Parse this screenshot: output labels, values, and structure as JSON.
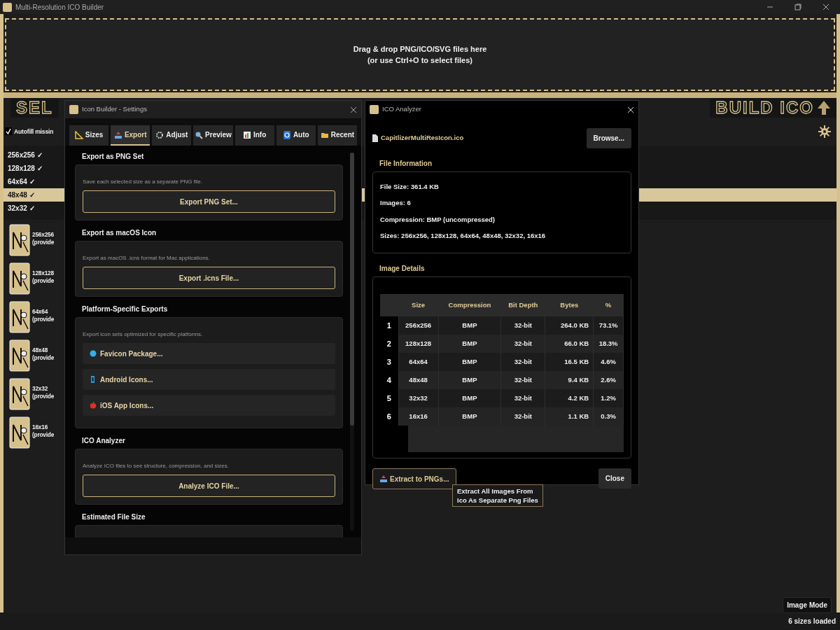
{
  "window": {
    "title": "Multi-Resolution ICO Builder"
  },
  "drop_zone": {
    "line_1": "Drag & drop PNG/ICO/SVG files here",
    "line_2": "(or use Ctrl+O to select files)"
  },
  "select_button": {
    "label": "SEL"
  },
  "build_button": {
    "label": "BUILD ICO"
  },
  "autofill": {
    "label": "Autofill missin",
    "checked": true
  },
  "sizes": [
    {
      "label": "256x256 ✓",
      "selected": false
    },
    {
      "label": "128x128 ✓",
      "selected": false
    },
    {
      "label": "64x64 ✓",
      "selected": false
    },
    {
      "label": "48x48 ✓",
      "selected": true
    },
    {
      "label": "32x32 ✓",
      "selected": false
    }
  ],
  "thumbnails": [
    {
      "size": "256x256",
      "note": "(provide"
    },
    {
      "size": "128x128",
      "note": "(provide"
    },
    {
      "size": "64x64",
      "note": "(provide"
    },
    {
      "size": "48x48",
      "note": "(provide"
    },
    {
      "size": "32x32",
      "note": "(provide"
    },
    {
      "size": "16x16",
      "note": "(provide"
    }
  ],
  "settings_dialog": {
    "title": "Icon Builder - Settings",
    "tabs": [
      {
        "label": "Sizes",
        "selected": false
      },
      {
        "label": "Export",
        "selected": true
      },
      {
        "label": "Adjust",
        "selected": false
      },
      {
        "label": "Preview",
        "selected": false
      },
      {
        "label": "Info",
        "selected": false
      },
      {
        "label": "Auto",
        "selected": false
      },
      {
        "label": "Recent",
        "selected": false
      }
    ],
    "sections": [
      {
        "title": "Export as PNG Set",
        "description": "Save each selected size as a separate PNG file.",
        "buttons": [
          {
            "label": "Export PNG Set...",
            "kind": "outlined"
          }
        ]
      },
      {
        "title": "Export as macOS Icon",
        "description": "Export as macOS .icns format for Mac applications.",
        "buttons": [
          {
            "label": "Export .icns File...",
            "kind": "outlined"
          }
        ]
      },
      {
        "title": "Platform-Specific Exports",
        "description": "Export icon sets optimized for specific platforms.",
        "buttons": [
          {
            "label": "Favicon Package...",
            "kind": "flat"
          },
          {
            "label": "Android Icons...",
            "kind": "flat"
          },
          {
            "label": "iOS App Icons...",
            "kind": "flat"
          }
        ]
      },
      {
        "title": "ICO Analyzer",
        "description": "Analyze ICO files to see structure, compression, and sizes.",
        "buttons": [
          {
            "label": "Analyze ICO File...",
            "kind": "outlined"
          }
        ]
      },
      {
        "title": "Estimated File Size"
      }
    ]
  },
  "analyzer": {
    "title": "ICO Analyzer",
    "file_name": "CapitlizerMultiResIcon.ico",
    "browse_button": "Browse...",
    "file_info": {
      "title": "File Information",
      "lines": [
        "File Size: 361.4 KB",
        "Images: 6",
        "Compression: BMP (uncompressed)",
        "Sizes: 256x256, 128x128, 64x64, 48x48, 32x32, 16x16"
      ]
    },
    "image_details": {
      "title": "Image Details",
      "columns": [
        "",
        "Size",
        "Compression",
        "Bit Depth",
        "Bytes",
        "%"
      ],
      "rows": [
        [
          "1",
          "256x256",
          "BMP",
          "32-bit",
          "264.0 KB",
          "73.1%"
        ],
        [
          "2",
          "128x128",
          "BMP",
          "32-bit",
          "66.0 KB",
          "18.3%"
        ],
        [
          "3",
          "64x64",
          "BMP",
          "32-bit",
          "16.5 KB",
          "4.6%"
        ],
        [
          "4",
          "48x48",
          "BMP",
          "32-bit",
          "9.4 KB",
          "2.6%"
        ],
        [
          "5",
          "32x32",
          "BMP",
          "32-bit",
          "4.2 KB",
          "1.2%"
        ],
        [
          "6",
          "16x16",
          "BMP",
          "32-bit",
          "1.1 KB",
          "0.3%"
        ]
      ]
    },
    "extract_button": "Extract to PNGs...",
    "close_button": "Close",
    "tooltip": [
      "Extract All Images From",
      "Ico As Separate Png Files"
    ]
  },
  "status": {
    "mode": "Image Mode",
    "text": "6 sizes loaded"
  }
}
